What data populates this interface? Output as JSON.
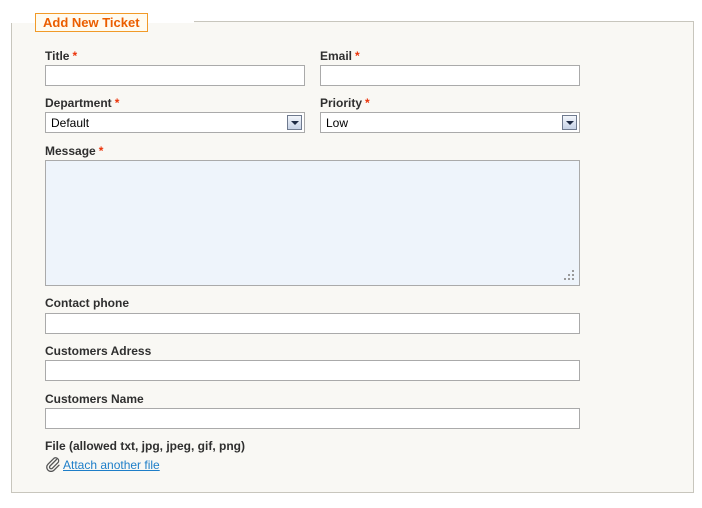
{
  "form": {
    "legend": "Add New Ticket",
    "required_mark": "*",
    "fields": {
      "title": {
        "label": "Title",
        "value": ""
      },
      "email": {
        "label": "Email",
        "value": ""
      },
      "department": {
        "label": "Department",
        "selected": "Default"
      },
      "priority": {
        "label": "Priority",
        "selected": "Low"
      },
      "message": {
        "label": "Message",
        "value": ""
      },
      "contact_phone": {
        "label": "Contact phone",
        "value": ""
      },
      "customers_address": {
        "label": "Customers Adress",
        "value": ""
      },
      "customers_name": {
        "label": "Customers Name",
        "value": ""
      },
      "file": {
        "label": "File (allowed txt, jpg, jpeg, gif, png)"
      }
    },
    "attach_link": "Attach another file"
  },
  "icons": {
    "select_arrow": "chevron-down-icon",
    "attachment": "paperclip-icon",
    "resize": "resize-grip-icon"
  },
  "colors": {
    "legend_text": "#eb5e00",
    "legend_border": "#f19a28",
    "required": "#eb340a",
    "link": "#1e7ec8",
    "panel_bg": "#f9f8f4",
    "textarea_bg": "#eef4fb"
  }
}
